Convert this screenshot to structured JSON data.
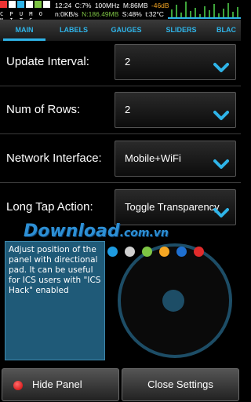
{
  "status_bar": {
    "logo_letters": "C P U M O N I T S",
    "line1": {
      "time": "12:24",
      "cpu": "C:7%",
      "freq": "100MHz",
      "mem": "M:86MB",
      "signal": "-46dB"
    },
    "line2": {
      "net_up": "n:0KB/s",
      "net_down": "N:186.49MB",
      "battery": "S:48%",
      "temp": "t:32°C"
    }
  },
  "tabs": [
    {
      "label": "MAIN",
      "active": true
    },
    {
      "label": "LABELS",
      "active": false
    },
    {
      "label": "GAUGES",
      "active": false
    },
    {
      "label": "SLIDERS",
      "active": false
    },
    {
      "label": "BLAC",
      "active": false
    }
  ],
  "settings": [
    {
      "label": "Update Interval:",
      "value": "2"
    },
    {
      "label": "Num of Rows:",
      "value": "2"
    },
    {
      "label": "Network Interface:",
      "value": "Mobile+WiFi"
    },
    {
      "label": "Long Tap Action:",
      "value": "Toggle Transparency"
    }
  ],
  "help_text": "Adjust position of the panel with directional pad. It can be useful for ICS users with \"ICS Hack\" enabled",
  "color_dots": [
    "#1e9be0",
    "#d0d0d0",
    "#7ec544",
    "#f5a623",
    "#1e6fd0",
    "#e02b2b"
  ],
  "watermark": {
    "main": "Download",
    "suffix": ".com.vn"
  },
  "buttons": {
    "hide_panel": "Hide Panel",
    "close_settings": "Close Settings"
  },
  "colors": {
    "accent": "#2fb4e8",
    "help_bg": "#1f5a78",
    "dpad": "#1d4d66"
  }
}
